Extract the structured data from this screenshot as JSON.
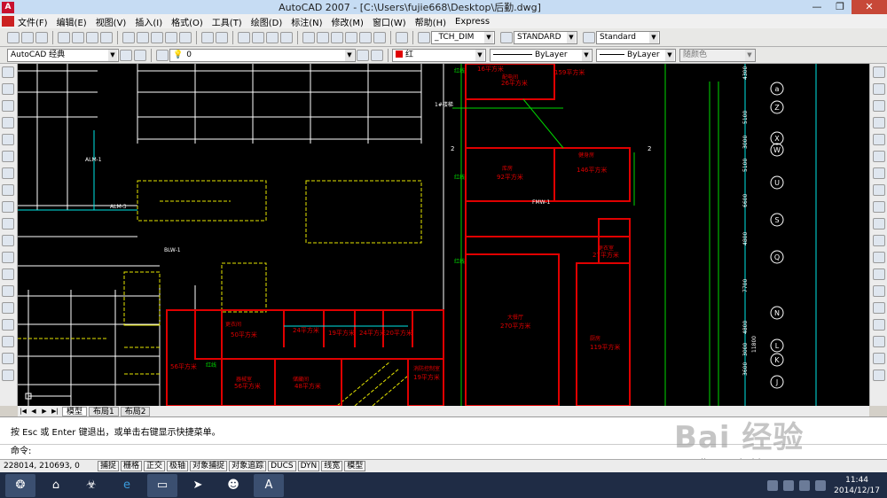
{
  "window": {
    "icon_label": "A",
    "title": "AutoCAD 2007 - [C:\\Users\\fujie668\\Desktop\\后勤.dwg]",
    "minimize": "—",
    "restore": "❐",
    "close": "✕"
  },
  "menu": {
    "items": [
      "文件(F)",
      "编辑(E)",
      "视图(V)",
      "插入(I)",
      "格式(O)",
      "工具(T)",
      "绘图(D)",
      "标注(N)",
      "修改(M)",
      "窗口(W)",
      "帮助(H)",
      "Express"
    ]
  },
  "toolbar1": {
    "dimstyle": "_TCH_DIM",
    "textstyle": "STANDARD",
    "tablestyle": "Standard"
  },
  "toolbar2": {
    "workspace": "AutoCAD 经典",
    "layer": "0",
    "color": "红",
    "linetype": "ByLayer",
    "lineweight": "ByLayer",
    "plotstyle": "随颜色"
  },
  "canvas": {
    "labels": [
      "1#楼梯",
      "FMW-1",
      "BLW-1",
      "ALM-3",
      "ALM-1",
      "2",
      "2",
      "16平方米",
      "26平方米",
      "159平方米",
      "92平方米",
      "146平方米",
      "27平方米",
      "270平方米",
      "119平方米",
      "50平方米",
      "24平方米",
      "19平方米",
      "24平方米",
      "20平方米",
      "56平方米",
      "56平方米",
      "48平方米",
      "19平方米",
      "配电间",
      "健身房",
      "库房",
      "消防控制室",
      "更衣室",
      "更衣间",
      "器械室",
      "储藏间",
      "大餐厅",
      "厨房",
      "红线",
      "红线",
      "红线",
      "红线"
    ],
    "grid_right": [
      "a",
      "Z",
      "X",
      "W",
      "U",
      "S",
      "Q",
      "N",
      "L",
      "K",
      "J"
    ],
    "dims": [
      "4300",
      "5100",
      "5100",
      "3000",
      "6600",
      "4800",
      "7700",
      "4800",
      "3000",
      "3600",
      "11800"
    ]
  },
  "tabs": {
    "items": [
      "模型",
      "布局1",
      "布局2"
    ]
  },
  "command": {
    "history": "按 Esc 或 Enter 键退出，或单击右键显示快捷菜单。",
    "prompt": "命令:"
  },
  "status": {
    "coords": "228014, 210693, 0",
    "toggles": [
      "捕捉",
      "栅格",
      "正交",
      "极轴",
      "对象捕捉",
      "对象追踪",
      "DUCS",
      "DYN",
      "线宽",
      "模型"
    ]
  },
  "watermark": {
    "logo": "Bai 经验",
    "url": "jingyan.baidu.com"
  },
  "taskbar": {
    "time": "11:44",
    "date": "2014/12/17"
  },
  "colors": {
    "canvas": "#000000",
    "red_walls": "#e00000",
    "yellow_lines": "#e6e600",
    "white_lines": "#ffffff",
    "cyan_lines": "#00e6e6",
    "green_lines": "#00d800",
    "taskbar": "#1f2c45"
  }
}
